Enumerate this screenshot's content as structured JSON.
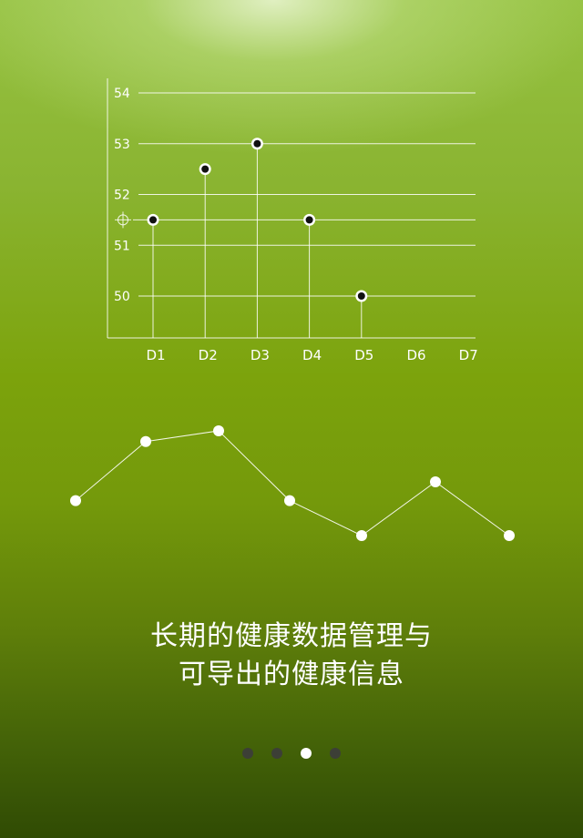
{
  "tagline": {
    "line1": "长期的健康数据管理与",
    "line2": "可导出的健康信息"
  },
  "pager": {
    "count": 4,
    "active_index": 2
  },
  "colors": {
    "line": "#ffffff",
    "point_fill": "#111111",
    "dot_inactive": "#3c3f36",
    "dot_active": "#ffffff"
  },
  "chart_data": [
    {
      "type": "scatter",
      "style": "stem",
      "categories": [
        "D1",
        "D2",
        "D3",
        "D4",
        "D5",
        "D6",
        "D7"
      ],
      "values": [
        51.5,
        52.5,
        53,
        51.5,
        50,
        null,
        null
      ],
      "y_ticks": [
        50,
        51,
        52,
        53,
        54
      ],
      "ylim": [
        49.5,
        54.3
      ],
      "reference_line": {
        "value": 51.5,
        "icon": "crosshair-icon"
      },
      "grid": true
    },
    {
      "type": "line",
      "values": [
        4.2,
        6.4,
        6.8,
        4.2,
        2.9,
        4.9,
        2.9
      ],
      "ylim": [
        0,
        7.5
      ],
      "axes": false
    }
  ]
}
